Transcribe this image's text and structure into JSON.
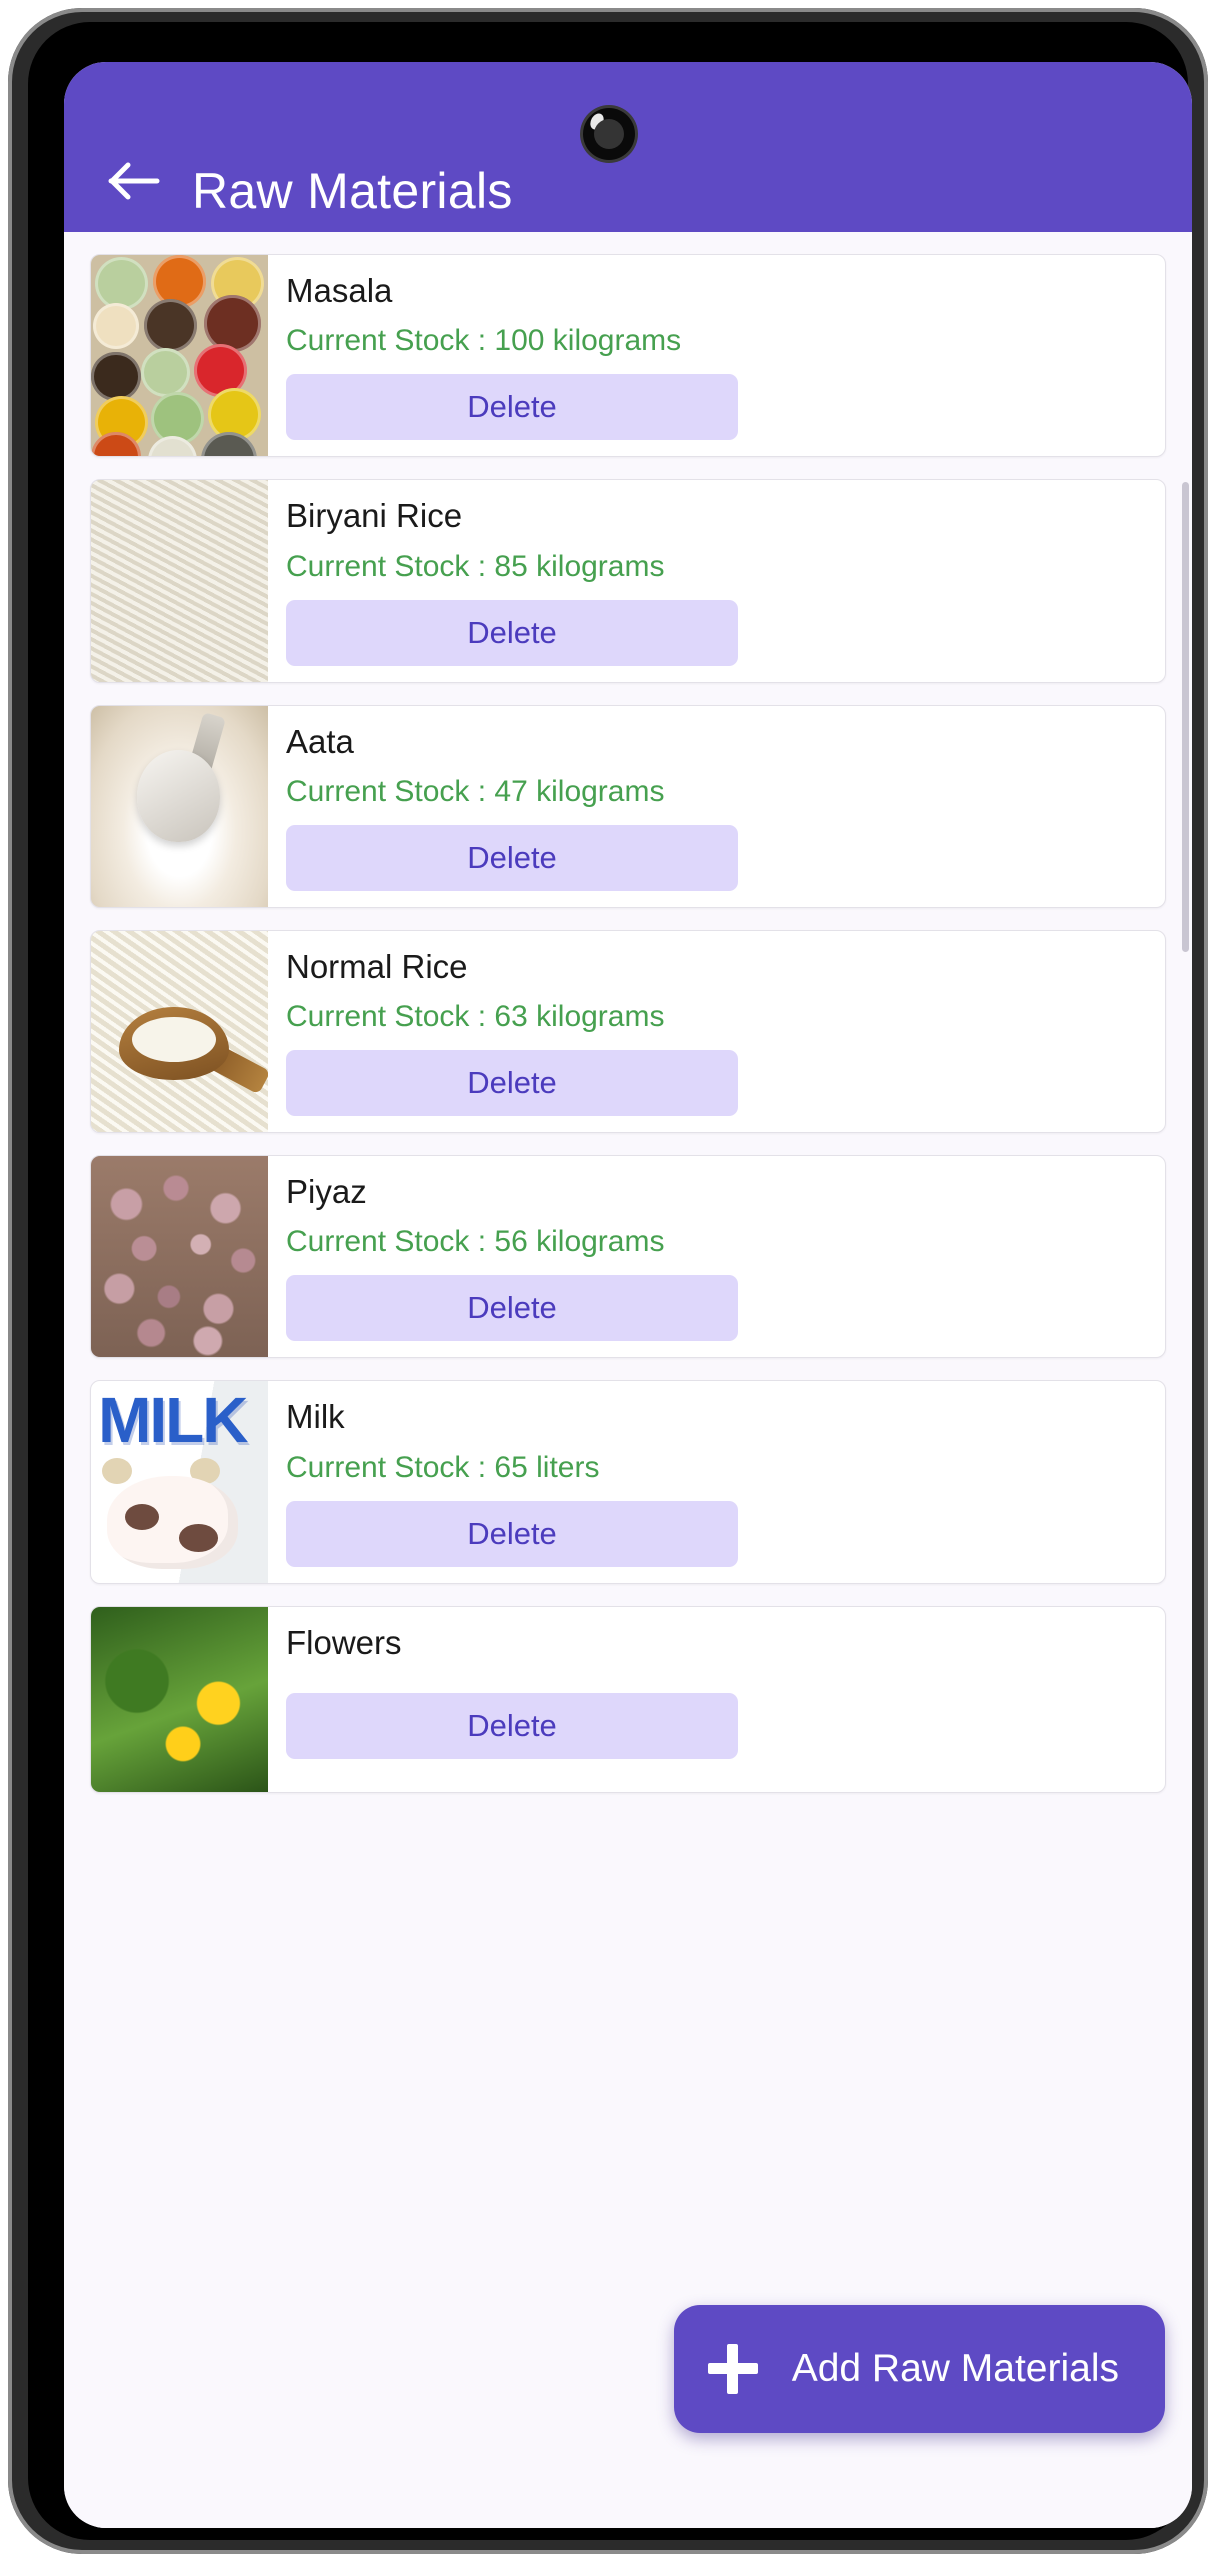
{
  "app": {
    "title": "Raw Materials",
    "header_bg": "#5E4AC4",
    "back_icon": "arrow-left-icon"
  },
  "fab": {
    "label": "Add Raw Materials",
    "icon": "plus-icon",
    "bg": "#5E4AC4"
  },
  "common": {
    "delete_label": "Delete",
    "stock_prefix": "Current Stock : ",
    "stock_color": "#46A04F",
    "delete_bg": "#DED7FB",
    "delete_text_color": "#4B3BBD"
  },
  "items": [
    {
      "name": "Masala",
      "stock": "Current Stock : 100 kilograms",
      "quantity": 100,
      "unit": "kilograms",
      "delete_label": "Delete",
      "image": "spices-bowls-photo"
    },
    {
      "name": "Biryani Rice",
      "stock": "Current Stock : 85 kilograms",
      "quantity": 85,
      "unit": "kilograms",
      "delete_label": "Delete",
      "image": "basmati-rice-photo"
    },
    {
      "name": "Aata",
      "stock": "Current Stock : 47 kilograms",
      "quantity": 47,
      "unit": "kilograms",
      "delete_label": "Delete",
      "image": "flour-scoop-photo"
    },
    {
      "name": "Normal Rice",
      "stock": "Current Stock : 63 kilograms",
      "quantity": 63,
      "unit": "kilograms",
      "delete_label": "Delete",
      "image": "rice-wooden-spoon-photo"
    },
    {
      "name": "Piyaz",
      "stock": "Current Stock : 56 kilograms",
      "quantity": 56,
      "unit": "kilograms",
      "delete_label": "Delete",
      "image": "onions-pile-photo"
    },
    {
      "name": "Milk",
      "stock": "Current Stock : 65 liters",
      "quantity": 65,
      "unit": "liters",
      "delete_label": "Delete",
      "image": "milk-carton-photo",
      "image_text": "MILK"
    },
    {
      "name": "Flowers",
      "stock": "",
      "delete_label": "Delete",
      "image": "yellow-flowers-photo"
    }
  ]
}
